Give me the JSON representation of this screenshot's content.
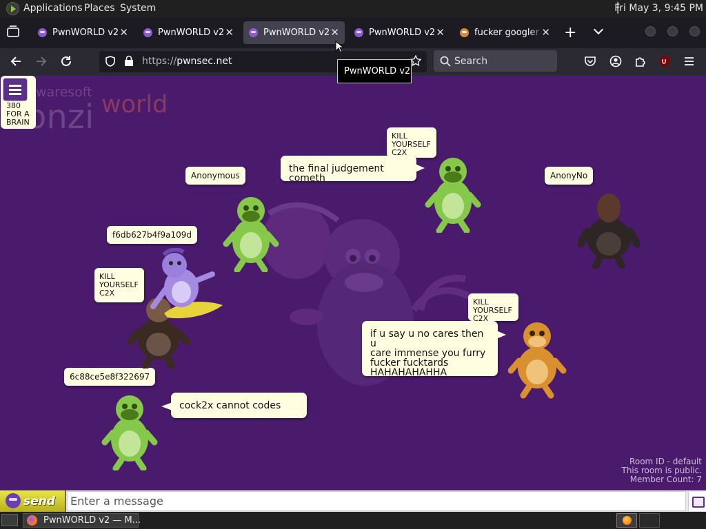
{
  "top_panel": {
    "menus": [
      "Applications",
      "Places",
      "System"
    ],
    "clock": "Fri May  3,  9:45 PM"
  },
  "browser": {
    "tabs": [
      {
        "label": "PwnWORLD v2",
        "active": false
      },
      {
        "label": "PwnWORLD v2",
        "active": false
      },
      {
        "label": "PwnWORLD v2",
        "active": true
      },
      {
        "label": "PwnWORLD v2",
        "active": false
      },
      {
        "label": "fucker googler -",
        "active": false
      }
    ],
    "close_glyph": "✕",
    "new_tab_glyph": "+",
    "url_protocol": "https://",
    "url_host": "pwnsec.net",
    "search_placeholder": "Search",
    "tooltip": "PwnWORLD v2"
  },
  "stage": {
    "watermark": {
      "brand": "waresoft",
      "name": "onzi",
      "world": "world"
    },
    "user_card": [
      "380",
      "FOR A",
      "BRAIN"
    ],
    "nametags": {
      "anonymous": "Anonymous",
      "f6db": "f6db627b4f9a109d",
      "c88": "6c88ce5e8f322697",
      "anonyno": "AnonyNo"
    },
    "bubbles": {
      "judgement": "the final judgement cometh",
      "cock2x": "cock2x cannot codes",
      "furry": [
        "if u say u no cares then u",
        "care immense you furry",
        "fucker fucktards",
        "HAHAHAHAHHA"
      ],
      "kill_top": [
        "KILL",
        "YOURSELF",
        "C2X"
      ],
      "kill_left": [
        "KILL",
        "YOURSELF",
        "C2X"
      ],
      "kill_right": [
        "KILL",
        "YOURSELF",
        "C2X"
      ]
    },
    "room_info": {
      "id": "Room ID - default",
      "public": "This room is public.",
      "members": "Member Count: 7"
    }
  },
  "chat": {
    "send_label": "send",
    "placeholder": "Enter a message"
  },
  "taskbar": {
    "window_title": "PwnWORLD v2 — M..."
  },
  "colors": {
    "stage_bg": "#4a1a6c",
    "bubble_bg": "#fffee1",
    "send_yellow": "#e8e545",
    "purple_bonzi": "#8a5bd6",
    "green_bonzi": "#7fbf3a",
    "brown_bonzi": "#5a3a28",
    "orange_bonzi": "#d9902e"
  }
}
